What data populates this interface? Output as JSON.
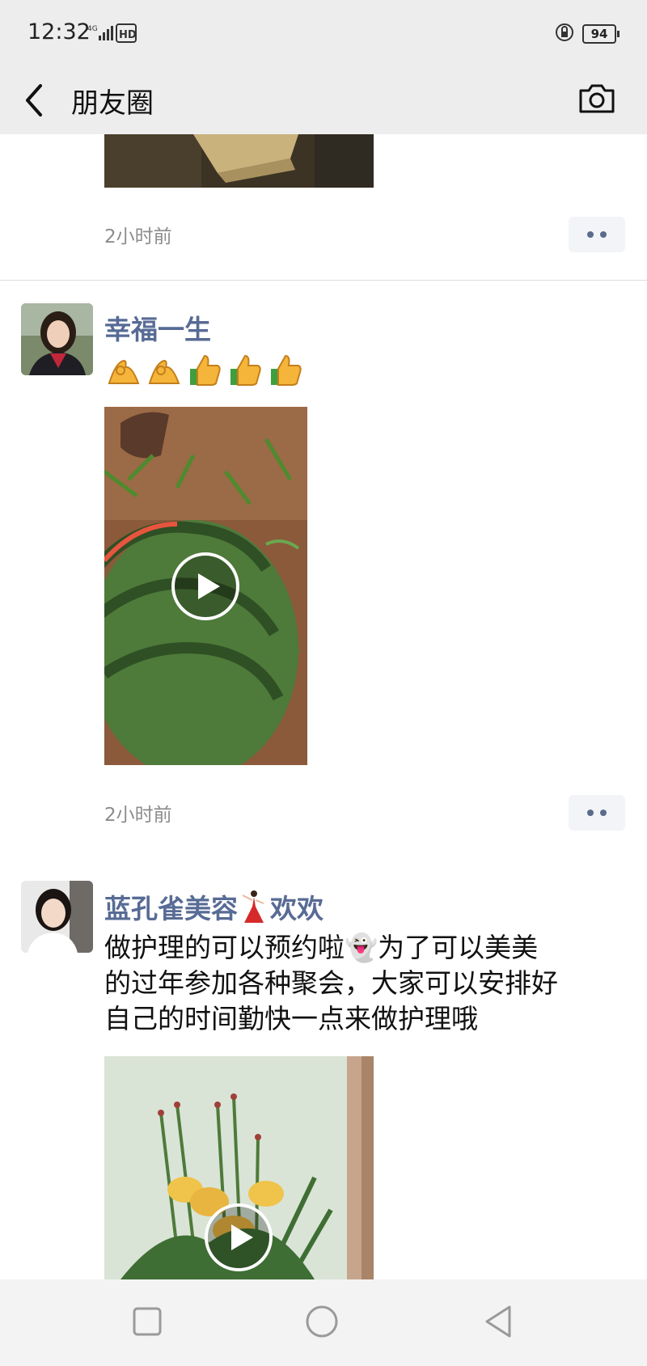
{
  "status_bar": {
    "time": "12:32",
    "network": "4G",
    "hd": "HD",
    "battery": "94"
  },
  "header": {
    "title": "朋友圈"
  },
  "posts": [
    {
      "timestamp": "2小时前"
    },
    {
      "username": "幸福一生",
      "emojis": [
        "ok-hand",
        "ok-hand",
        "thumbs-up",
        "thumbs-up",
        "thumbs-up"
      ],
      "media": "video",
      "timestamp": "2小时前"
    },
    {
      "username": "蓝孔雀美容",
      "username_suffix": "欢欢",
      "text": "做护理的可以预约啦👻为了可以美美\n的过年参加各种聚会，大家可以安排好\n自己的时间勤快一点来做护理哦",
      "media": "video"
    }
  ],
  "system_nav": [
    "recents",
    "home",
    "back"
  ],
  "colors": {
    "accent_name": "#576b95",
    "header_bg": "#ededed",
    "timestamp": "#8c8c8c"
  }
}
